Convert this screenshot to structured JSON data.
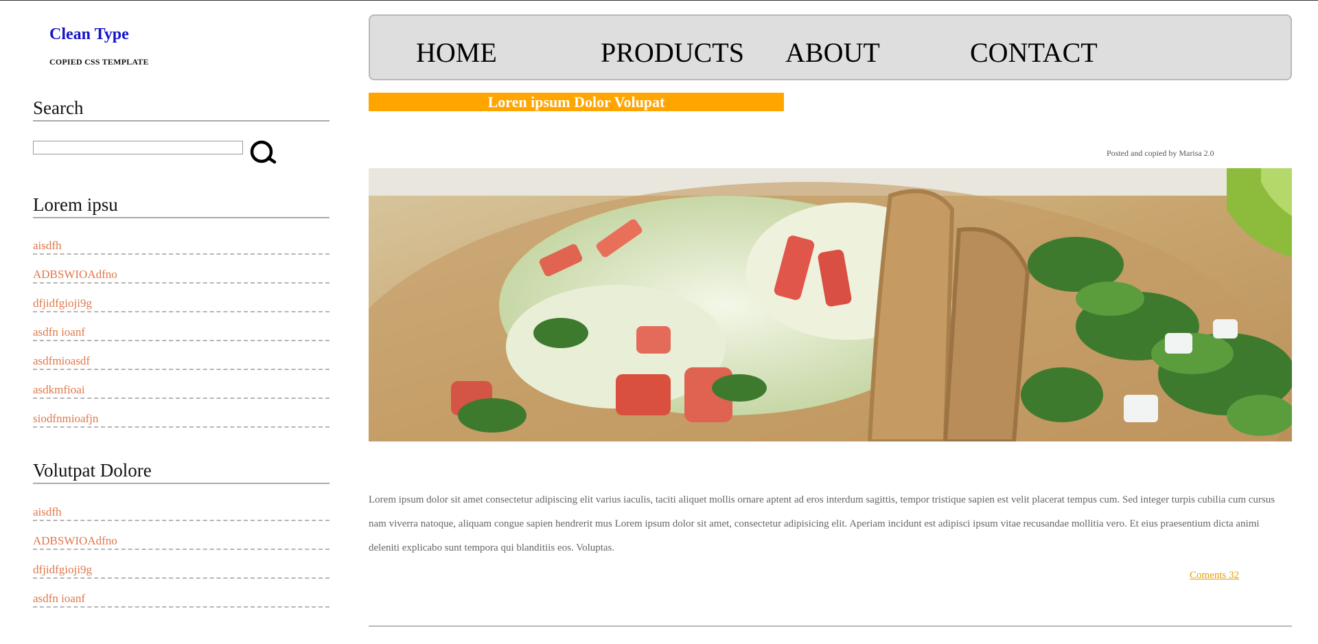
{
  "brand": {
    "title": "Clean Type",
    "subtitle": "COPIED CSS TEMPLATE"
  },
  "sidebar": {
    "search": {
      "heading": "Search",
      "input_value": "",
      "button_icon": "search-icon"
    },
    "section1": {
      "heading": "Lorem ipsu",
      "items": [
        "aisdfh",
        "ADBSWIOAdfno",
        "dfjidfgioji9g",
        "asdfn ioanf",
        "asdfmioasdf",
        "asdkmfioai",
        "siodfnmioafjn"
      ]
    },
    "section2": {
      "heading": "Volutpat Dolore",
      "items": [
        "aisdfh",
        "ADBSWIOAdfno",
        "dfjidfgioji9g",
        "asdfn ioanf"
      ]
    }
  },
  "nav": {
    "items": [
      "HOME",
      "PRODUCTS",
      "ABOUT",
      "CONTACT"
    ]
  },
  "post": {
    "title": "Loren ipsum Dolor Volupat",
    "meta": "Posted and copied by Marisa 2.0",
    "image": "tacos-photo",
    "body": "Lorem ipsum dolor sit amet consectetur adipiscing elit varius iaculis, taciti aliquet mollis ornare aptent ad eros interdum sagittis, tempor tristique sapien est velit placerat tempus cum. Sed integer turpis cubilia cum cursus nam viverra natoque, aliquam congue sapien hendrerit mus Lorem ipsum dolor sit amet, consectetur adipisicing elit. Aperiam incidunt est adipisci ipsum vitae recusandae mollitia vero. Et eius praesentium dicta animi deleniti explicabo sunt tempora qui blanditiis eos. Voluptas.",
    "comments": "Coments 32"
  },
  "colors": {
    "brand": "#1515c8",
    "link": "#e0774a",
    "title_bar": "#ffa500",
    "nav_bg": "#dedede",
    "comments": "#e6a000"
  }
}
